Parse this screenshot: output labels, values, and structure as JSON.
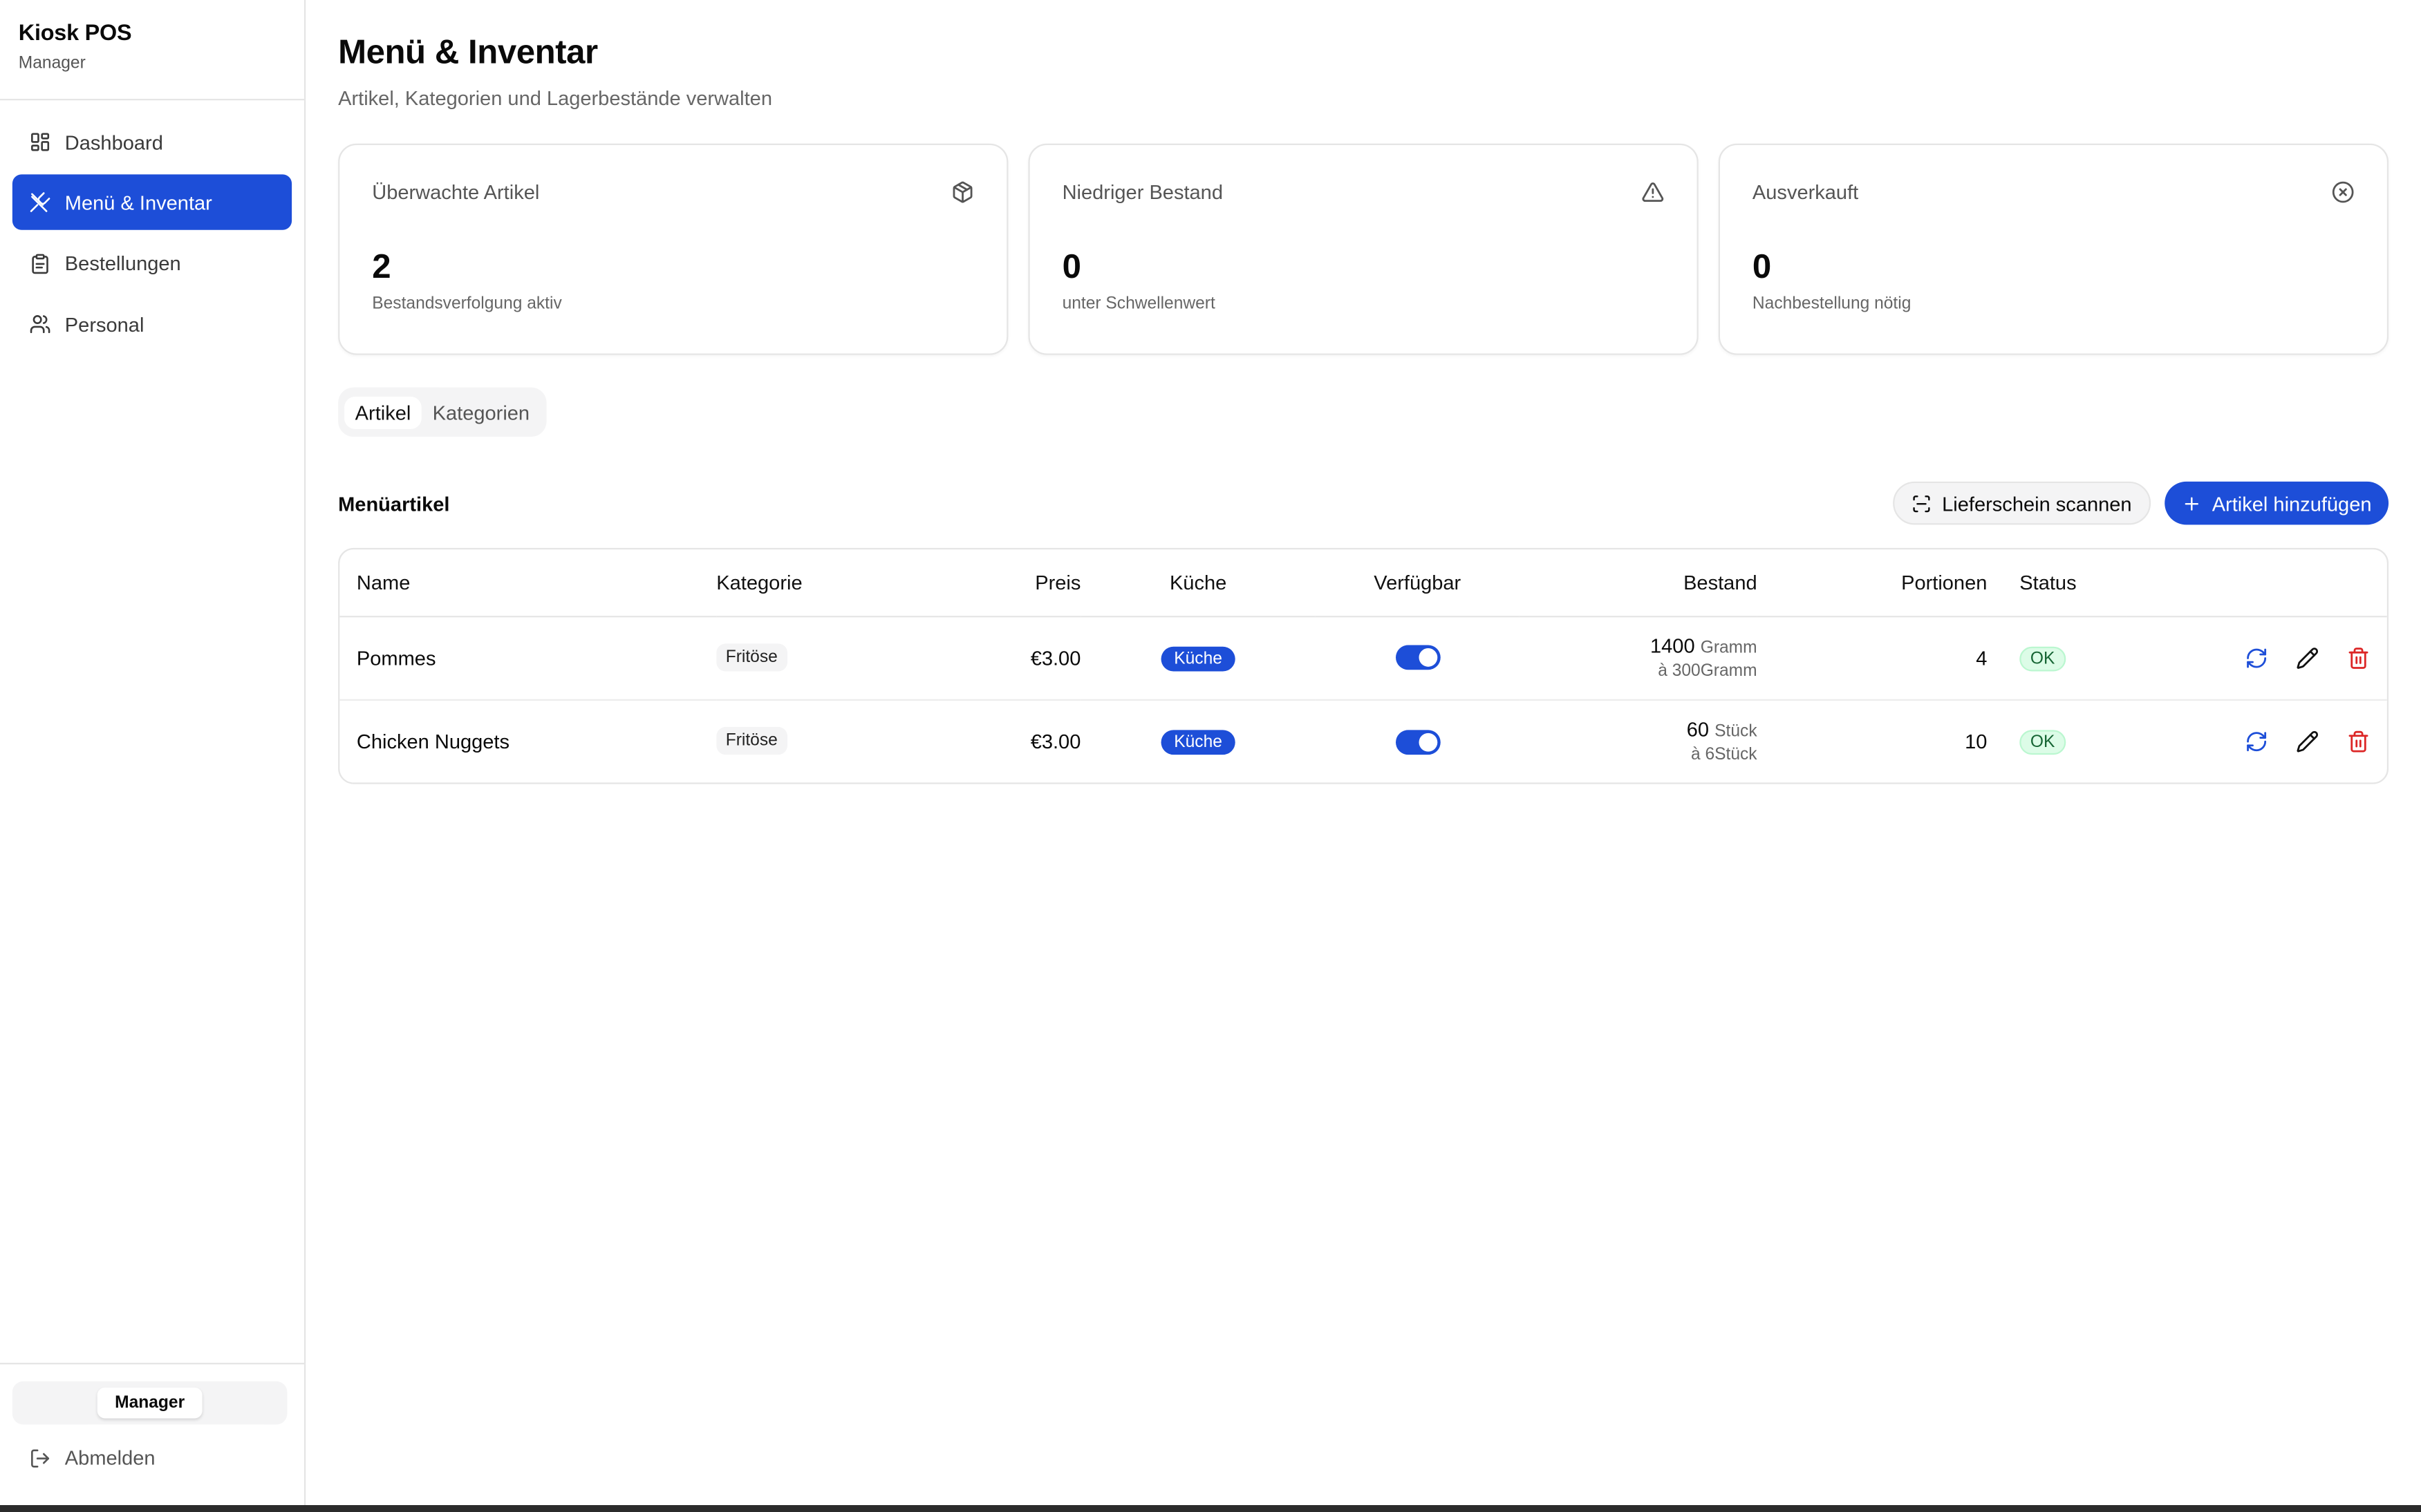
{
  "app": {
    "title": "Kiosk POS",
    "role": "Manager"
  },
  "sidebar": {
    "items": [
      {
        "label": "Dashboard",
        "icon": "layout-grid-icon"
      },
      {
        "label": "Menü & Inventar",
        "icon": "utensils-icon",
        "active": true
      },
      {
        "label": "Bestellungen",
        "icon": "clipboard-icon"
      },
      {
        "label": "Personal",
        "icon": "users-icon"
      }
    ],
    "role_switch": "Manager",
    "logout": "Abmelden"
  },
  "header": {
    "title": "Menü & Inventar",
    "subtitle": "Artikel, Kategorien und Lagerbestände verwalten"
  },
  "stats": [
    {
      "label": "Überwachte Artikel",
      "value": "2",
      "note": "Bestandsverfolgung aktiv",
      "icon": "package-icon"
    },
    {
      "label": "Niedriger Bestand",
      "value": "0",
      "note": "unter Schwellenwert",
      "icon": "warning-triangle-icon"
    },
    {
      "label": "Ausverkauft",
      "value": "0",
      "note": "Nachbestellung nötig",
      "icon": "x-circle-icon"
    }
  ],
  "tabs": [
    {
      "label": "Artikel",
      "active": true
    },
    {
      "label": "Kategorien",
      "active": false
    }
  ],
  "section": {
    "title": "Menüartikel",
    "scan_button": "Lieferschein scannen",
    "add_button": "Artikel hinzufügen"
  },
  "table": {
    "columns": [
      "Name",
      "Kategorie",
      "Preis",
      "Küche",
      "Verfügbar",
      "Bestand",
      "Portionen",
      "Status"
    ],
    "rows": [
      {
        "name": "Pommes",
        "category": "Fritöse",
        "price": "€3.00",
        "kitchen": "Küche",
        "available": true,
        "stock": "1400",
        "stock_unit": "Gramm",
        "stock_sub": "à 300Gramm",
        "portions": "4",
        "status": "OK"
      },
      {
        "name": "Chicken Nuggets",
        "category": "Fritöse",
        "price": "€3.00",
        "kitchen": "Küche",
        "available": true,
        "stock": "60",
        "stock_unit": "Stück",
        "stock_sub": "à 6Stück",
        "portions": "10",
        "status": "OK"
      }
    ]
  },
  "colors": {
    "accent": "#1d4ed8",
    "danger": "#dc2626",
    "ok_bg": "#dcfce7",
    "ok_text": "#166534"
  }
}
